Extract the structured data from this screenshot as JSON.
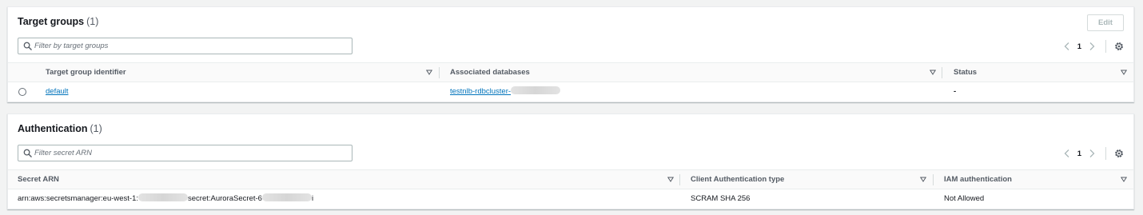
{
  "target_groups": {
    "title": "Target groups",
    "count": "(1)",
    "edit_label": "Edit",
    "filter_placeholder": "Filter by target groups",
    "page": "1",
    "columns": [
      "Target group identifier",
      "Associated databases",
      "Status"
    ],
    "rows": [
      {
        "identifier": "default",
        "database": "testnlb-rdbcluster-",
        "status": "-"
      }
    ]
  },
  "authentication": {
    "title": "Authentication",
    "count": "(1)",
    "filter_placeholder": "Filter secret ARN",
    "page": "1",
    "columns": [
      "Secret ARN",
      "Client Authentication type",
      "IAM authentication"
    ],
    "rows": [
      {
        "arn_prefix": "arn:aws:secretsmanager:eu-west-1:",
        "arn_middle": "secret:AuroraSecret-6",
        "arn_suffix": "i",
        "auth_type": "SCRAM SHA 256",
        "iam": "Not Allowed"
      }
    ]
  },
  "colors": {
    "link": "#0073bb",
    "background": "#f2f3f3",
    "header_text": "#545b64"
  },
  "icons": [
    "search-icon",
    "chevron-left-icon",
    "chevron-right-icon",
    "gear-icon",
    "sort-down-icon",
    "radio-icon"
  ]
}
